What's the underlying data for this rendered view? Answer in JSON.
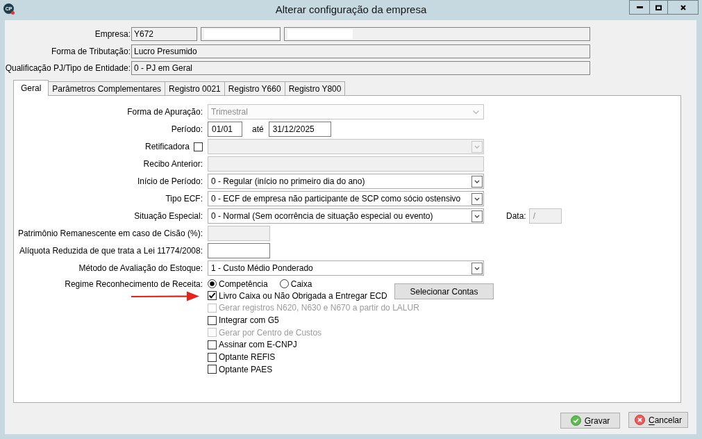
{
  "window": {
    "title": "Alterar configuração da empresa",
    "app_icon_text": "CP"
  },
  "header_rows": [
    {
      "label": "Empresa:",
      "fields": [
        {
          "value": "Y672",
          "redacted": false
        },
        {
          "redacted": true
        },
        {
          "redacted": true
        }
      ]
    },
    {
      "label": "Forma de Tributação:",
      "fields": [
        {
          "value": "Lucro Presumido",
          "redacted": false
        }
      ]
    },
    {
      "label": "Qualificação PJ/Tipo de Entidade:",
      "fields": [
        {
          "value": "0 - PJ em Geral",
          "redacted": false
        }
      ]
    }
  ],
  "tabs": [
    {
      "label": "Geral",
      "selected": true
    },
    {
      "label": "Parâmetros Complementares",
      "selected": false
    },
    {
      "label": "Registro 0021",
      "selected": false
    },
    {
      "label": "Registro Y660",
      "selected": false
    },
    {
      "label": "Registro Y800",
      "selected": false
    }
  ],
  "form": {
    "rows": [
      {
        "kind": "select",
        "label": "Forma de Apuração:",
        "value": "Trimestral",
        "disabled": true
      },
      {
        "kind": "period",
        "label": "Período:",
        "from": "01/01",
        "separator": "até",
        "to": "31/12/2025"
      },
      {
        "kind": "check_select",
        "label": "Retificadora",
        "checked": false,
        "disabled": true
      },
      {
        "kind": "textfield",
        "label": "Recibo Anterior:",
        "disabled": true
      },
      {
        "kind": "select",
        "label": "Início de Período:",
        "value": "0 - Regular (início no primeiro dia do ano)",
        "disabled": false
      },
      {
        "kind": "select",
        "label": "Tipo ECF:",
        "value": "0 - ECF de empresa não participante de SCP como sócio ostensivo",
        "disabled": false
      },
      {
        "kind": "select",
        "label": "Situação Especial:",
        "value": "0 - Normal (Sem ocorrência de situação especial ou evento)",
        "disabled": false,
        "extra": {
          "label": "Data:",
          "value": "/",
          "disabled": true
        }
      },
      {
        "kind": "numberfield",
        "label": "Patrimônio Remanescente em caso de Cisão (%):",
        "disabled": true
      },
      {
        "kind": "numberfield",
        "label": "Alíquota Reduzida de que trata a Lei 11774/2008:",
        "disabled": false
      },
      {
        "kind": "select",
        "label": "Método de Avaliação do Estoque:",
        "value": "1 - Custo Médio Ponderado",
        "disabled": false
      },
      {
        "kind": "radio",
        "label": "Regime Reconhecimento de Receita:",
        "options": [
          {
            "label": "Competência",
            "selected": true
          },
          {
            "label": "Caixa",
            "selected": false
          }
        ],
        "button": "Selecionar Contas"
      }
    ],
    "checkboxes": [
      {
        "label": "Livro Caixa ou Não Obrigada a Entregar ECD",
        "checked": true,
        "disabled": false,
        "annotated": true
      },
      {
        "label": "Gerar registros N620, N630 e N670 a partir do LALUR",
        "checked": false,
        "disabled": true,
        "annotated": false
      },
      {
        "label": "Integrar com G5",
        "checked": false,
        "disabled": false,
        "annotated": false
      },
      {
        "label": "Gerar por Centro de Custos",
        "checked": false,
        "disabled": true,
        "annotated": false
      },
      {
        "label": "Assinar com E-CNPJ",
        "checked": false,
        "disabled": false,
        "annotated": false
      },
      {
        "label": "Optante REFIS",
        "checked": false,
        "disabled": false,
        "annotated": false
      },
      {
        "label": "Optante PAES",
        "checked": false,
        "disabled": false,
        "annotated": false
      }
    ]
  },
  "footer_buttons": [
    {
      "kind": "confirm",
      "label": "Gravar"
    },
    {
      "kind": "cancel",
      "label": "Cancelar"
    }
  ]
}
